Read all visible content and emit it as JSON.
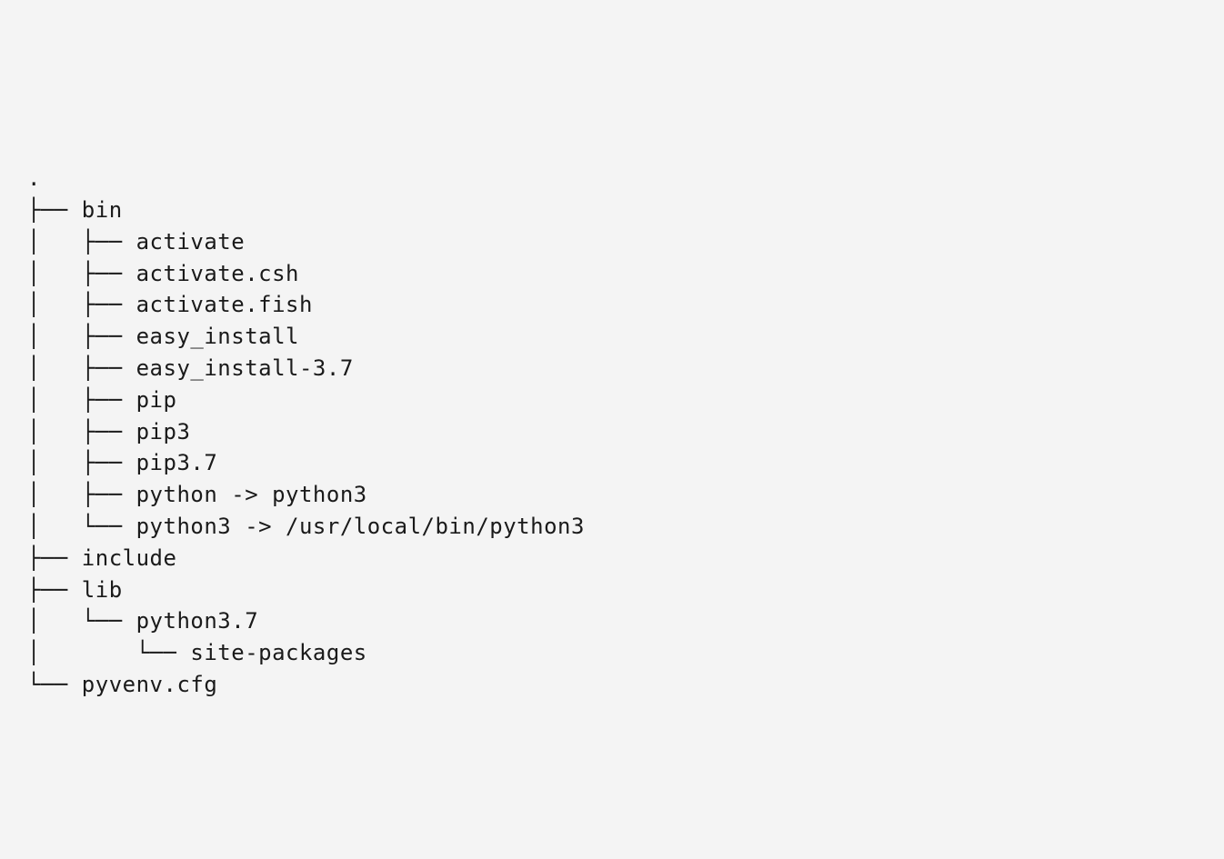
{
  "tree": {
    "root": ".",
    "lines": [
      "├── bin",
      "│   ├── activate",
      "│   ├── activate.csh",
      "│   ├── activate.fish",
      "│   ├── easy_install",
      "│   ├── easy_install-3.7",
      "│   ├── pip",
      "│   ├── pip3",
      "│   ├── pip3.7",
      "│   ├── python -> python3",
      "│   └── python3 -> /usr/local/bin/python3",
      "├── include",
      "├── lib",
      "│   └── python3.7",
      "│       └── site-packages",
      "└── pyvenv.cfg"
    ]
  }
}
